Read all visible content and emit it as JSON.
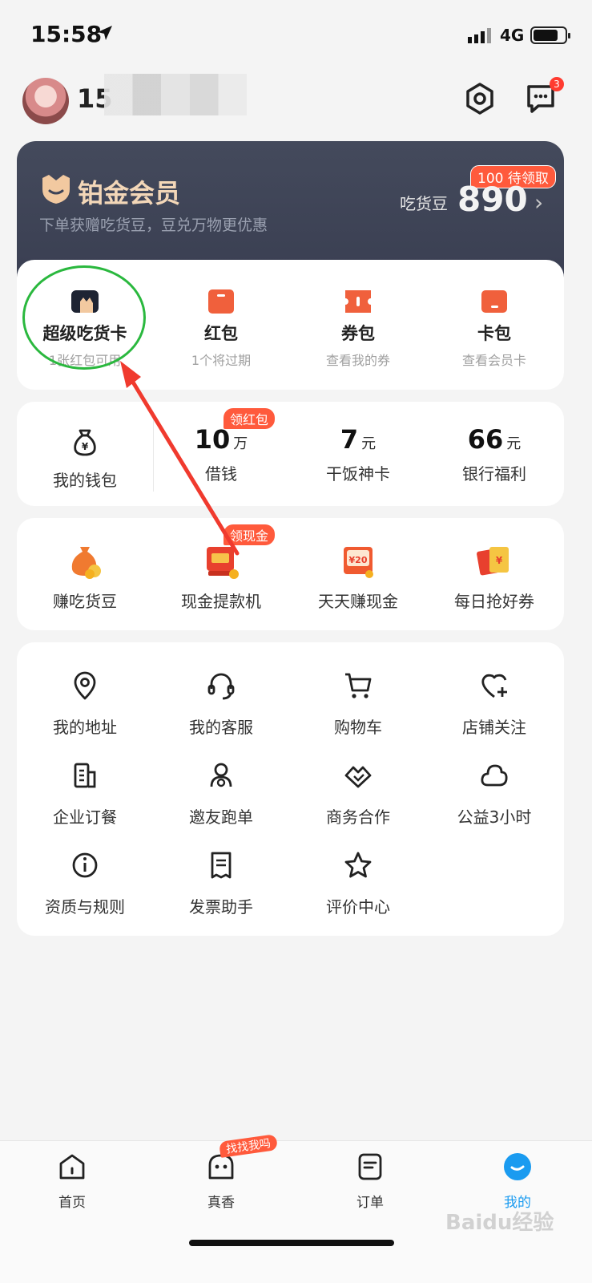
{
  "status_bar": {
    "time": "15:58",
    "network": "4G",
    "battery_level": 0.8
  },
  "profile": {
    "username": "15",
    "message_badge": "3"
  },
  "member": {
    "title": "铂金会员",
    "subtitle": "下单获赠吃货豆，豆兑万物更优惠",
    "beans_label": "吃货豆",
    "beans_count": "890",
    "badge": "100 待领取"
  },
  "top_items": [
    {
      "title": "超级吃货卡",
      "sub": "1张红包可用"
    },
    {
      "title": "红包",
      "sub": "1个将过期"
    },
    {
      "title": "券包",
      "sub": "查看我的券"
    },
    {
      "title": "卡包",
      "sub": "查看会员卡"
    }
  ],
  "finance": {
    "wallet_label": "我的钱包",
    "items": [
      {
        "value": "10",
        "unit": "万",
        "label": "借钱",
        "tag": "领红包"
      },
      {
        "value": "7",
        "unit": "元",
        "label": "干饭神卡",
        "tag": ""
      },
      {
        "value": "66",
        "unit": "元",
        "label": "银行福利",
        "tag": ""
      }
    ]
  },
  "earn": [
    {
      "label": "赚吃货豆",
      "tag": ""
    },
    {
      "label": "现金提款机",
      "tag": "领现金"
    },
    {
      "label": "天天赚现金",
      "tag": "",
      "coupon": "¥20"
    },
    {
      "label": "每日抢好券",
      "tag": ""
    }
  ],
  "services": [
    {
      "label": "我的地址",
      "icon": "location-icon"
    },
    {
      "label": "我的客服",
      "icon": "headset-icon"
    },
    {
      "label": "购物车",
      "icon": "cart-icon"
    },
    {
      "label": "店铺关注",
      "icon": "heart-plus-icon"
    },
    {
      "label": "企业订餐",
      "icon": "building-icon"
    },
    {
      "label": "邀友跑单",
      "icon": "rider-icon"
    },
    {
      "label": "商务合作",
      "icon": "handshake-icon"
    },
    {
      "label": "公益3小时",
      "icon": "charity-icon"
    },
    {
      "label": "资质与规则",
      "icon": "info-icon"
    },
    {
      "label": "发票助手",
      "icon": "invoice-icon"
    },
    {
      "label": "评价中心",
      "icon": "star-icon"
    }
  ],
  "tabbar": {
    "items": [
      {
        "label": "首页",
        "active": false
      },
      {
        "label": "真香",
        "active": false,
        "badge": "找找我吗"
      },
      {
        "label": "订单",
        "active": false
      },
      {
        "label": "我的",
        "active": true
      }
    ]
  },
  "colors": {
    "accent": "#1a9bf0",
    "red": "#ff5a3c",
    "member_bg": "#3f4457",
    "annotation_green": "#2ab83e",
    "annotation_red": "#f03a2e"
  },
  "watermark": "Baidu经验"
}
